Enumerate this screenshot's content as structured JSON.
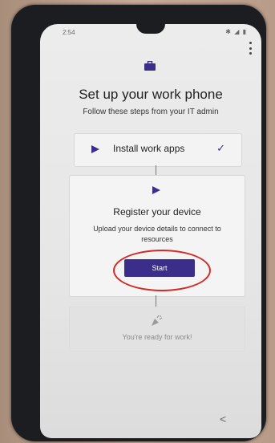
{
  "status_bar": {
    "time": "2:54",
    "icons": "✱ ◢ ▮"
  },
  "header": {
    "title": "Set up your work phone",
    "subtitle": "Follow these steps from your IT admin"
  },
  "steps": [
    {
      "label": "Install work apps",
      "status": "complete",
      "icon": "play-arrow-icon",
      "check_icon": "check-icon"
    },
    {
      "title": "Register your device",
      "description": "Upload your device details to connect to resources",
      "button_label": "Start",
      "icon": "play-arrow-icon"
    },
    {
      "label": "You're ready for work!",
      "status": "disabled",
      "icon": "celebration-icon"
    }
  ],
  "navigation": {
    "back_glyph": "<"
  },
  "colors": {
    "accent": "#3b2d8a",
    "annotation_circle": "#d42a2a",
    "screen_background": "#ececec"
  }
}
